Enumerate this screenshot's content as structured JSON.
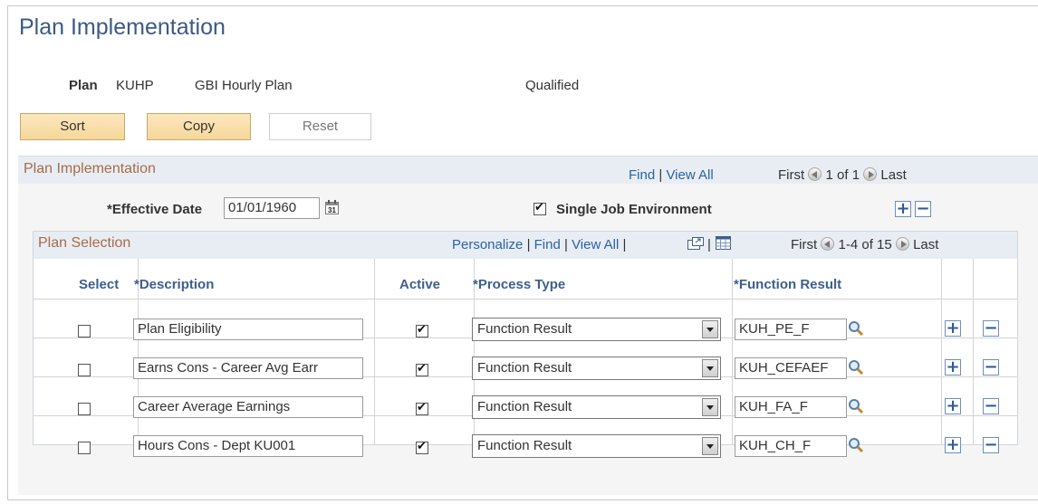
{
  "page_title": "Plan Implementation",
  "plan": {
    "label": "Plan",
    "code": "KUHP",
    "description": "GBI Hourly Plan",
    "status": "Qualified"
  },
  "buttons": {
    "sort": "Sort",
    "copy": "Copy",
    "reset": "Reset"
  },
  "group": {
    "title": "Plan Implementation",
    "find": "Find",
    "sep": "|",
    "view_all": "View All",
    "first": "First",
    "range": "1 of 1",
    "last": "Last",
    "effective_date_label": "*Effective Date",
    "effective_date": "01/01/1960",
    "single_job_label": "Single Job Environment",
    "single_job_checked": true
  },
  "grid": {
    "title": "Plan Selection",
    "personalize": "Personalize",
    "find": "Find",
    "view_all": "View All",
    "sep": "|",
    "first": "First",
    "range": "1-4 of 15",
    "last": "Last",
    "columns": {
      "select": "Select",
      "description": "*Description",
      "active": "Active",
      "process_type": "*Process Type",
      "function_result": "*Function Result"
    },
    "rows": [
      {
        "selected": false,
        "description": "Plan Eligibility",
        "active": true,
        "process_type": "Function Result",
        "function_result": "KUH_PE_F"
      },
      {
        "selected": false,
        "description": "Earns Cons - Career Avg Earr",
        "active": true,
        "process_type": "Function Result",
        "function_result": "KUH_CEFAEF"
      },
      {
        "selected": false,
        "description": "Career Average Earnings",
        "active": true,
        "process_type": "Function Result",
        "function_result": "KUH_FA_F"
      },
      {
        "selected": false,
        "description": "Hours Cons - Dept KU001",
        "active": true,
        "process_type": "Function Result",
        "function_result": "KUH_CH_F"
      }
    ]
  },
  "icons": {
    "add": "+",
    "remove": "−"
  },
  "colors": {
    "title": "#3c5a84",
    "link": "#2863a8",
    "group_title": "#a86b49",
    "button": "#f6d79a"
  }
}
